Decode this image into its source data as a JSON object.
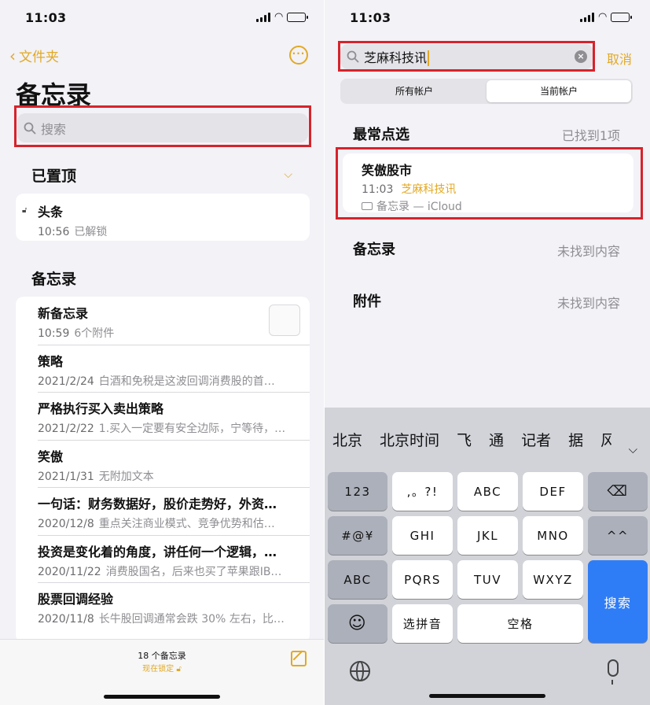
{
  "colors": {
    "accent": "#e2a925",
    "highlight_box": "#d7232b",
    "keyboard_return": "#2f7df6"
  },
  "left": {
    "status_time": "11:03",
    "back_label": "文件夹",
    "title": "备忘录",
    "search_placeholder": "搜索",
    "pinned_header": "已置顶",
    "pinned": [
      {
        "title": "头条",
        "date": "10:56",
        "detail": "已解锁"
      }
    ],
    "notes_header": "备忘录",
    "notes": [
      {
        "title": "新备忘录",
        "date": "10:59",
        "detail": "6个附件"
      },
      {
        "title": "策略",
        "date": "2021/2/24",
        "detail": "白酒和免税是这波回调消费股的首…"
      },
      {
        "title": "严格执行买入卖出策略",
        "date": "2021/2/22",
        "detail": "1.买入一定要有安全边际，宁等待，…"
      },
      {
        "title": "笑傲",
        "date": "2021/1/31",
        "detail": "无附加文本"
      },
      {
        "title": "一句话：财务数据好，股价走势好，外资…",
        "date": "2020/12/8",
        "detail": "重点关注商业模式、竞争优势和估…"
      },
      {
        "title": "投资是变化着的角度，讲任何一个逻辑，…",
        "date": "2020/11/22",
        "detail": "消费股国名，后来也买了苹果跟IB…"
      },
      {
        "title": "股票回调经验",
        "date": "2020/11/8",
        "detail": "长牛股回调通常会跌 30% 左右，比…"
      }
    ],
    "toolbar_count": "18 个备忘录",
    "toolbar_lock": "现在锁定"
  },
  "right": {
    "status_time": "11:03",
    "search_value": "芝麻科技讯",
    "cancel_label": "取消",
    "segments": [
      "所有帐户",
      "当前帐户"
    ],
    "active_segment": 1,
    "top_hits_header": "最常点选",
    "top_hits_count": "已找到1项",
    "result": {
      "title": "笑傲股市",
      "time": "11:03",
      "match": "芝麻科技讯",
      "folder": "备忘录 — iCloud"
    },
    "notes_header": "备忘录",
    "notes_status": "未找到内容",
    "attach_header": "附件",
    "attach_status": "未找到内容"
  },
  "keyboard": {
    "candidates": [
      "北京",
      "北京时间",
      "飞",
      "通",
      "记者",
      "据",
      "风"
    ],
    "rows": [
      [
        "123",
        ",。?!",
        "ABC",
        "DEF",
        "⌫"
      ],
      [
        "#@¥",
        "GHI",
        "JKL",
        "MNO",
        "^^"
      ],
      [
        "ABC",
        "PQRS",
        "TUV",
        "WXYZ"
      ],
      [
        "☺",
        "选拼音",
        "空格"
      ]
    ],
    "return_label": "搜索",
    "globe": "globe-icon",
    "mic": "mic-icon"
  }
}
